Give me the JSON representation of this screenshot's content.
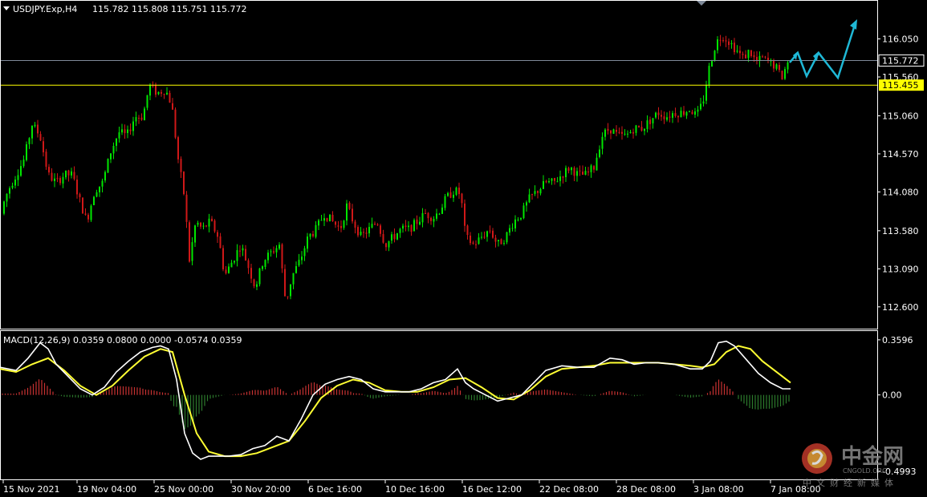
{
  "header": {
    "symbol": "USDJPY.Exp,H4",
    "ohlc": "115.782 115.808 115.751 115.772"
  },
  "macd_header": "MACD(12,26,9) 0.0359 0.0800 0.0000 -0.0574 0.0359",
  "colors": {
    "background": "#000000",
    "bull": "#00e600",
    "bear": "#d01818",
    "grid_border": "#ffffff",
    "current_line": "#7f8a99",
    "level_line": "#ffff00",
    "macd_line": "#ffffff",
    "signal_line": "#ffff33",
    "hist_pos": "#c83232",
    "hist_neg": "#2d7a2d",
    "arrows": "#1fb8d6"
  },
  "chart_data": [
    {
      "type": "candlestick",
      "title": "USDJPY.Exp,H4",
      "ylim": [
        112.34,
        116.52
      ],
      "y_ticks": [
        "116.050",
        "115.560",
        "115.060",
        "114.570",
        "114.080",
        "113.580",
        "113.090",
        "112.600"
      ],
      "x_ticks": [
        "15 Nov 2021",
        "19 Nov 04:00",
        "25 Nov 00:00",
        "30 Nov 20:00",
        "6 Dec 16:00",
        "10 Dec 16:00",
        "16 Dec 12:00",
        "22 Dec 08:00",
        "28 Dec 08:00",
        "3 Jan 08:00",
        "7 Jan 08:00"
      ],
      "current_price": {
        "label": "115.772",
        "value": 115.772
      },
      "level": {
        "label": "115.455",
        "value": 115.455
      },
      "price_path": [
        [
          0,
          113.8
        ],
        [
          10,
          114.1
        ],
        [
          20,
          114.3
        ],
        [
          30,
          114.5
        ],
        [
          40,
          114.95
        ],
        [
          50,
          114.8
        ],
        [
          60,
          114.3
        ],
        [
          70,
          114.2
        ],
        [
          80,
          114.3
        ],
        [
          90,
          114.3
        ],
        [
          100,
          113.95
        ],
        [
          108,
          113.7
        ],
        [
          118,
          114.1
        ],
        [
          128,
          114.2
        ],
        [
          138,
          114.6
        ],
        [
          148,
          114.85
        ],
        [
          158,
          114.8
        ],
        [
          168,
          115.05
        ],
        [
          178,
          115.05
        ],
        [
          186,
          115.45
        ],
        [
          196,
          115.35
        ],
        [
          206,
          115.4
        ],
        [
          214,
          115.2
        ],
        [
          222,
          114.5
        ],
        [
          230,
          114.0
        ],
        [
          236,
          113.2
        ],
        [
          244,
          113.7
        ],
        [
          252,
          113.6
        ],
        [
          262,
          113.7
        ],
        [
          272,
          113.5
        ],
        [
          280,
          113.0
        ],
        [
          290,
          113.2
        ],
        [
          300,
          113.4
        ],
        [
          310,
          113.1
        ],
        [
          318,
          112.85
        ],
        [
          328,
          113.2
        ],
        [
          338,
          113.3
        ],
        [
          348,
          113.4
        ],
        [
          356,
          112.65
        ],
        [
          364,
          113.0
        ],
        [
          374,
          113.2
        ],
        [
          384,
          113.5
        ],
        [
          394,
          113.6
        ],
        [
          404,
          113.8
        ],
        [
          414,
          113.7
        ],
        [
          424,
          113.6
        ],
        [
          432,
          113.9
        ],
        [
          440,
          113.7
        ],
        [
          450,
          113.5
        ],
        [
          460,
          113.6
        ],
        [
          470,
          113.7
        ],
        [
          480,
          113.4
        ],
        [
          490,
          113.5
        ],
        [
          500,
          113.6
        ],
        [
          510,
          113.6
        ],
        [
          520,
          113.7
        ],
        [
          530,
          113.8
        ],
        [
          540,
          113.75
        ],
        [
          548,
          113.85
        ],
        [
          556,
          114.0
        ],
        [
          566,
          114.1
        ],
        [
          574,
          114.05
        ],
        [
          580,
          113.5
        ],
        [
          590,
          113.4
        ],
        [
          600,
          113.5
        ],
        [
          610,
          113.6
        ],
        [
          620,
          113.4
        ],
        [
          630,
          113.5
        ],
        [
          640,
          113.7
        ],
        [
          650,
          113.8
        ],
        [
          660,
          114.0
        ],
        [
          670,
          114.1
        ],
        [
          680,
          114.2
        ],
        [
          690,
          114.2
        ],
        [
          700,
          114.3
        ],
        [
          710,
          114.4
        ],
        [
          720,
          114.3
        ],
        [
          730,
          114.3
        ],
        [
          740,
          114.4
        ],
        [
          750,
          114.8
        ],
        [
          760,
          114.9
        ],
        [
          770,
          114.8
        ],
        [
          780,
          114.8
        ],
        [
          790,
          114.9
        ],
        [
          800,
          114.9
        ],
        [
          810,
          115.0
        ],
        [
          820,
          115.1
        ],
        [
          830,
          115.05
        ],
        [
          840,
          115.1
        ],
        [
          850,
          115.1
        ],
        [
          860,
          115.15
        ],
        [
          868,
          115.05
        ],
        [
          876,
          115.25
        ],
        [
          884,
          115.7
        ],
        [
          892,
          116.0
        ],
        [
          900,
          116.1
        ],
        [
          910,
          116.0
        ],
        [
          918,
          115.9
        ],
        [
          926,
          115.8
        ],
        [
          934,
          115.9
        ],
        [
          942,
          115.75
        ],
        [
          950,
          115.8
        ],
        [
          958,
          115.75
        ],
        [
          966,
          115.7
        ],
        [
          974,
          115.55
        ],
        [
          982,
          115.77
        ]
      ]
    },
    {
      "type": "line",
      "title": "MACD(12,26,9)",
      "ylim": [
        -0.53,
        0.38
      ],
      "y_ticks": [
        "0.3596",
        "0.00",
        "-0.4993"
      ],
      "series": [
        {
          "name": "MACD",
          "points": [
            [
              0,
              0.18
            ],
            [
              20,
              0.16
            ],
            [
              35,
              0.24
            ],
            [
              50,
              0.34
            ],
            [
              60,
              0.3
            ],
            [
              70,
              0.2
            ],
            [
              85,
              0.12
            ],
            [
              100,
              0.04
            ],
            [
              115,
              0.0
            ],
            [
              130,
              0.05
            ],
            [
              145,
              0.15
            ],
            [
              160,
              0.22
            ],
            [
              175,
              0.28
            ],
            [
              190,
              0.31
            ],
            [
              200,
              0.32
            ],
            [
              210,
              0.3
            ],
            [
              220,
              0.1
            ],
            [
              230,
              -0.25
            ],
            [
              240,
              -0.38
            ],
            [
              250,
              -0.42
            ],
            [
              260,
              -0.4
            ],
            [
              270,
              -0.4
            ],
            [
              285,
              -0.4
            ],
            [
              300,
              -0.39
            ],
            [
              315,
              -0.35
            ],
            [
              330,
              -0.33
            ],
            [
              345,
              -0.27
            ],
            [
              360,
              -0.3
            ],
            [
              375,
              -0.16
            ],
            [
              390,
              0.0
            ],
            [
              405,
              0.07
            ],
            [
              420,
              0.1
            ],
            [
              435,
              0.12
            ],
            [
              450,
              0.1
            ],
            [
              465,
              0.04
            ],
            [
              480,
              0.02
            ],
            [
              495,
              0.02
            ],
            [
              510,
              0.02
            ],
            [
              525,
              0.04
            ],
            [
              540,
              0.08
            ],
            [
              555,
              0.1
            ],
            [
              570,
              0.17
            ],
            [
              580,
              0.08
            ],
            [
              590,
              0.04
            ],
            [
              605,
              0.0
            ],
            [
              620,
              -0.04
            ],
            [
              635,
              -0.02
            ],
            [
              650,
              0.0
            ],
            [
              665,
              0.08
            ],
            [
              680,
              0.16
            ],
            [
              700,
              0.19
            ],
            [
              720,
              0.18
            ],
            [
              740,
              0.18
            ],
            [
              760,
              0.24
            ],
            [
              775,
              0.23
            ],
            [
              790,
              0.2
            ],
            [
              805,
              0.21
            ],
            [
              820,
              0.21
            ],
            [
              840,
              0.2
            ],
            [
              860,
              0.17
            ],
            [
              875,
              0.17
            ],
            [
              885,
              0.22
            ],
            [
              895,
              0.34
            ],
            [
              905,
              0.35
            ],
            [
              915,
              0.32
            ],
            [
              930,
              0.23
            ],
            [
              945,
              0.14
            ],
            [
              960,
              0.08
            ],
            [
              975,
              0.04
            ],
            [
              985,
              0.04
            ]
          ]
        },
        {
          "name": "Signal",
          "points": [
            [
              0,
              0.17
            ],
            [
              20,
              0.15
            ],
            [
              40,
              0.2
            ],
            [
              60,
              0.24
            ],
            [
              80,
              0.16
            ],
            [
              100,
              0.06
            ],
            [
              120,
              0.0
            ],
            [
              140,
              0.06
            ],
            [
              160,
              0.16
            ],
            [
              180,
              0.25
            ],
            [
              200,
              0.3
            ],
            [
              215,
              0.28
            ],
            [
              230,
              0.0
            ],
            [
              245,
              -0.25
            ],
            [
              260,
              -0.37
            ],
            [
              280,
              -0.4
            ],
            [
              300,
              -0.4
            ],
            [
              320,
              -0.38
            ],
            [
              340,
              -0.34
            ],
            [
              360,
              -0.3
            ],
            [
              380,
              -0.17
            ],
            [
              400,
              -0.02
            ],
            [
              420,
              0.06
            ],
            [
              440,
              0.1
            ],
            [
              460,
              0.08
            ],
            [
              480,
              0.03
            ],
            [
              500,
              0.02
            ],
            [
              520,
              0.02
            ],
            [
              540,
              0.05
            ],
            [
              560,
              0.1
            ],
            [
              580,
              0.11
            ],
            [
              600,
              0.05
            ],
            [
              620,
              -0.02
            ],
            [
              640,
              -0.03
            ],
            [
              660,
              0.03
            ],
            [
              680,
              0.12
            ],
            [
              700,
              0.17
            ],
            [
              720,
              0.18
            ],
            [
              740,
              0.19
            ],
            [
              760,
              0.21
            ],
            [
              780,
              0.21
            ],
            [
              800,
              0.21
            ],
            [
              820,
              0.21
            ],
            [
              840,
              0.2
            ],
            [
              860,
              0.19
            ],
            [
              875,
              0.18
            ],
            [
              890,
              0.2
            ],
            [
              905,
              0.28
            ],
            [
              920,
              0.32
            ],
            [
              935,
              0.3
            ],
            [
              950,
              0.22
            ],
            [
              965,
              0.16
            ],
            [
              985,
              0.08
            ]
          ]
        }
      ]
    }
  ]
}
